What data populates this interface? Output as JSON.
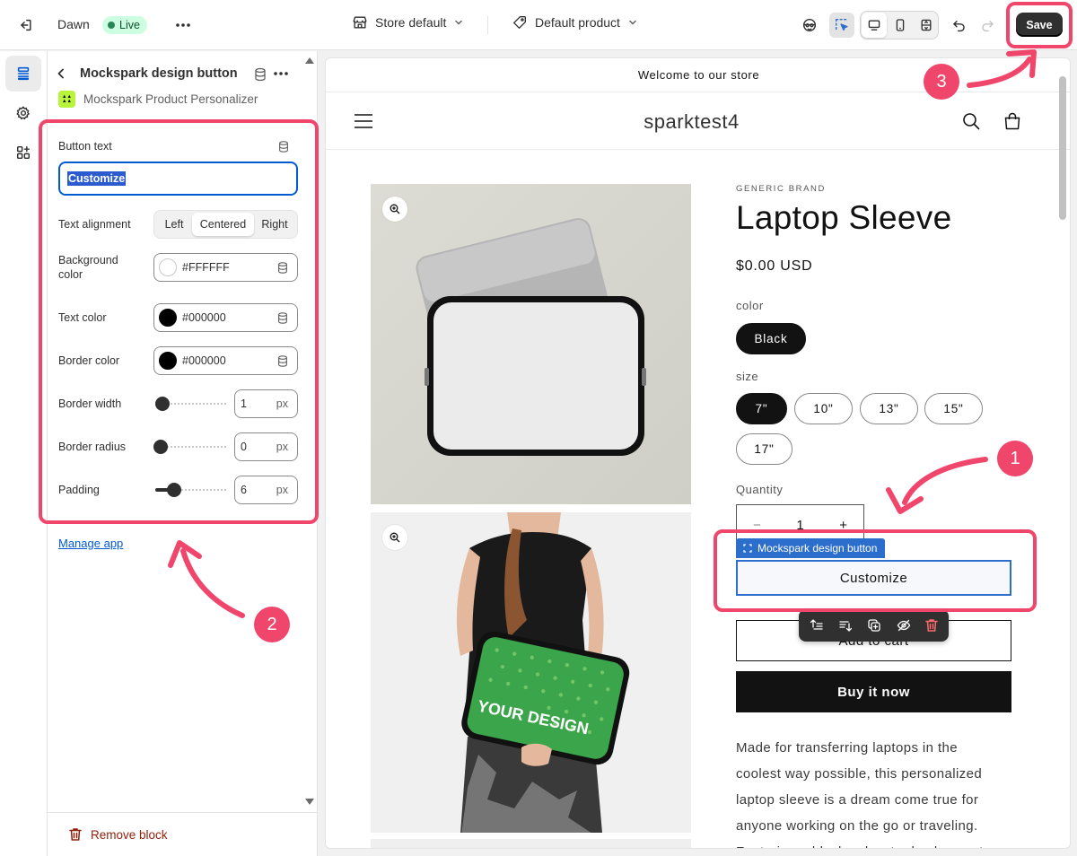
{
  "topbar": {
    "theme_name": "Dawn",
    "live_label": "Live",
    "store_select": "Store default",
    "product_select": "Default product",
    "save_label": "Save"
  },
  "panel": {
    "title": "Mockspark design button",
    "app_name": "Mockspark Product Personalizer",
    "fields": {
      "button_text_label": "Button text",
      "button_text_value": "Customize",
      "text_alignment_label": "Text alignment",
      "alignment_options": [
        "Left",
        "Centered",
        "Right"
      ],
      "alignment_selected": "Centered",
      "background_color_label": "Background color",
      "background_color_value": "#FFFFFF",
      "text_color_label": "Text color",
      "text_color_value": "#000000",
      "border_color_label": "Border color",
      "border_color_value": "#000000",
      "border_width_label": "Border width",
      "border_width_value": "1",
      "border_radius_label": "Border radius",
      "border_radius_value": "0",
      "padding_label": "Padding",
      "padding_value": "6",
      "unit": "px"
    },
    "manage_app_label": "Manage app",
    "remove_block_label": "Remove block"
  },
  "preview": {
    "announcement": "Welcome to our store",
    "store_name": "sparktest4",
    "brand": "GENERIC BRAND",
    "product_title": "Laptop Sleeve",
    "price": "$0.00 USD",
    "color_label": "color",
    "color_options": [
      "Black"
    ],
    "size_label": "size",
    "size_options": [
      "7\"",
      "10\"",
      "13\"",
      "15\"",
      "17\""
    ],
    "size_selected": "7\"",
    "quantity_label": "Quantity",
    "quantity_value": "1",
    "block_tag": "Mockspark design button",
    "customize_label": "Customize",
    "add_to_cart_label": "Add to cart",
    "buy_now_label": "Buy it now",
    "sleeve_print": "YOUR DESIGN",
    "description": "Made for transferring laptops in the coolest way possible, this personalized laptop sleeve is a dream come true for anyone working on the go or traveling. Featuring a black polyester back, a water"
  },
  "annotations": [
    "1",
    "2",
    "3"
  ],
  "colors": {
    "annotation": "#f0466c",
    "selection_blue": "#2c6ecb",
    "live_green": "#cdfee1",
    "logo_lime": "#b7f43b",
    "sleeve_green": "#3aa54a"
  },
  "icons": [
    "exit-icon",
    "ellipsis-icon",
    "store-icon",
    "tag-icon",
    "chevron-down-icon",
    "ai-icon",
    "inspector-icon",
    "desktop-icon",
    "mobile-icon",
    "fullscreen-icon",
    "undo-icon",
    "redo-icon",
    "sections-icon",
    "gear-icon",
    "apps-icon",
    "back-chevron-icon",
    "dynamic-source-icon",
    "menu-icon",
    "search-icon",
    "cart-icon",
    "zoom-icon",
    "trash-icon"
  ]
}
